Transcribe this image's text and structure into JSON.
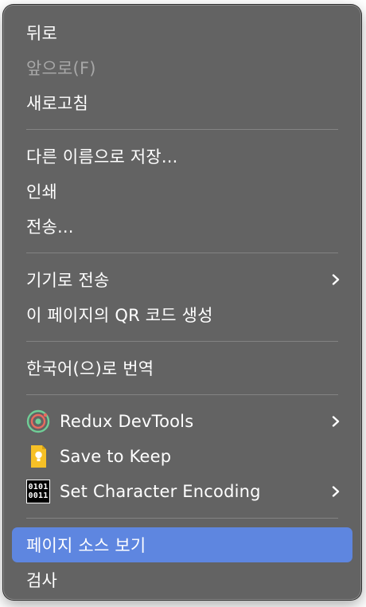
{
  "menu": {
    "groups": [
      [
        {
          "label": "뒤로",
          "enabled": true
        },
        {
          "label": "앞으로(F)",
          "enabled": false
        },
        {
          "label": "새로고침",
          "enabled": true
        }
      ],
      [
        {
          "label": "다른 이름으로 저장...",
          "enabled": true
        },
        {
          "label": "인쇄",
          "enabled": true
        },
        {
          "label": "전송...",
          "enabled": true
        }
      ],
      [
        {
          "label": "기기로 전송",
          "enabled": true,
          "submenu": true
        },
        {
          "label": "이 페이지의 QR 코드 생성",
          "enabled": true
        }
      ],
      [
        {
          "label": "한국어(으)로 번역",
          "enabled": true
        }
      ],
      [
        {
          "label": "Redux DevTools",
          "enabled": true,
          "submenu": true,
          "icon": "redux-devtools-icon"
        },
        {
          "label": "Save to Keep",
          "enabled": true,
          "icon": "keep-icon"
        },
        {
          "label": "Set Character Encoding",
          "enabled": true,
          "submenu": true,
          "icon": "character-encoding-icon",
          "icon_text": [
            "0101",
            "0011"
          ]
        }
      ],
      [
        {
          "label": "페이지 소스 보기",
          "enabled": true,
          "highlighted": true
        },
        {
          "label": "검사",
          "enabled": true
        }
      ]
    ]
  },
  "colors": {
    "menu_background": "#636363",
    "highlight": "#5e86e0",
    "text": "#ffffff",
    "disabled_text": "#a7a7a7",
    "separator": "#838383"
  }
}
